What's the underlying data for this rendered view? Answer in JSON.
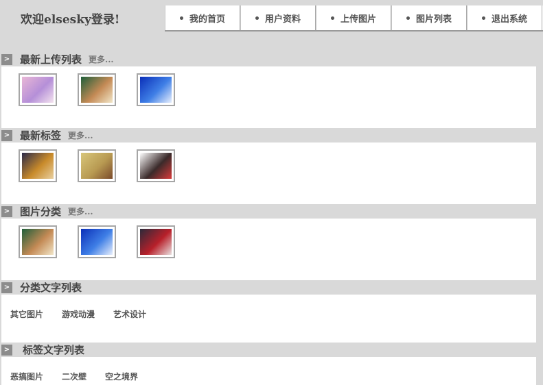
{
  "header": {
    "welcome": "欢迎elsesky登录!",
    "nav": [
      "我的首页",
      "用户资料",
      "上传图片",
      "图片列表",
      "退出系统"
    ]
  },
  "sections": [
    {
      "title": "最新上传列表",
      "more": "更多...",
      "thumbs": [
        {
          "icon": "anime-girl-pink-image",
          "colors": [
            "#e9b7d6",
            "#b58fd8",
            "#f4e3ee"
          ]
        },
        {
          "icon": "anime-girl-table-image",
          "colors": [
            "#1e5e3a",
            "#c48a55",
            "#f1e6c8"
          ]
        },
        {
          "icon": "blue-sky-figure-image",
          "colors": [
            "#0a2fb8",
            "#3f7fe6",
            "#e7eefc"
          ]
        }
      ]
    },
    {
      "title": "最新标签",
      "more": "更多...",
      "thumbs": [
        {
          "icon": "anime-creature-image",
          "colors": [
            "#2a2a4a",
            "#c88a2a",
            "#e8d0a0"
          ]
        },
        {
          "icon": "foxgirl-gold-image",
          "colors": [
            "#d8c67a",
            "#b89a52",
            "#7a4a2a"
          ]
        },
        {
          "icon": "chibi-girl-image",
          "colors": [
            "#ffffff",
            "#3a2a2a",
            "#d83a3a"
          ]
        }
      ]
    },
    {
      "title": "图片分类",
      "more": "更多...",
      "thumbs": [
        {
          "icon": "anime-girl-table-image",
          "colors": [
            "#1e5e3a",
            "#c48a55",
            "#f1e6c8"
          ]
        },
        {
          "icon": "blue-sky-figure-image",
          "colors": [
            "#0a2fb8",
            "#3f7fe6",
            "#e7eefc"
          ]
        },
        {
          "icon": "anime-couple-image",
          "colors": [
            "#2a2a3a",
            "#b8202a",
            "#e8e0e0"
          ]
        }
      ]
    },
    {
      "title": "分类文字列表",
      "links": [
        "其它图片",
        "游戏动漫",
        "艺术设计"
      ]
    },
    {
      "title": "标签文字列表",
      "links": [
        "恶搞图片",
        "二次壁",
        "空之境界"
      ]
    }
  ]
}
